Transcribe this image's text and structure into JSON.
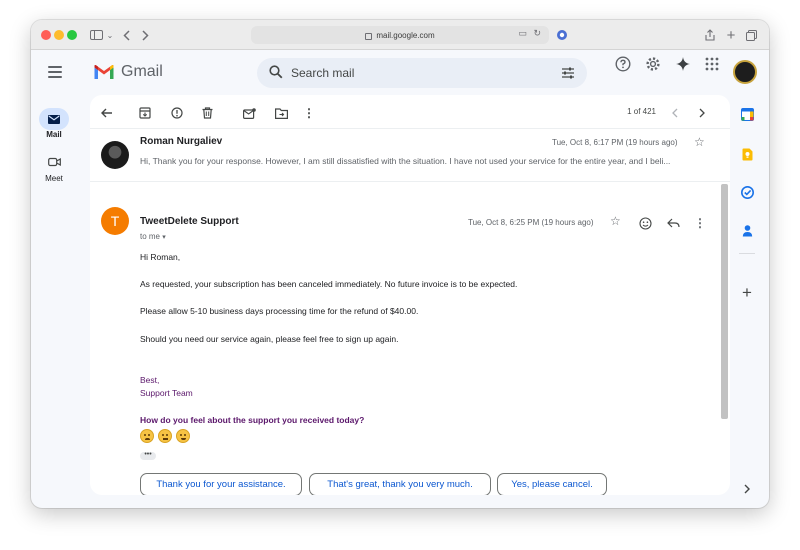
{
  "browser": {
    "url": "mail.google.com"
  },
  "gmail": {
    "logo_text": "Gmail",
    "search_placeholder": "Search mail"
  },
  "nav": {
    "mail_label": "Mail",
    "meet_label": "Meet"
  },
  "toolbar": {
    "pager": "1 of 421"
  },
  "thread": {
    "message1": {
      "sender": "Roman Nurgaliev",
      "date": "Tue, Oct 8, 6:17 PM (19 hours ago)",
      "snippet": "Hi, Thank you for your response. However, I am still dissatisfied with the situation. I have not used your service for the entire year, and I beli..."
    },
    "message2": {
      "avatar_letter": "T",
      "sender": "TweetDelete Support",
      "to": "to me",
      "date": "Tue, Oct 8, 6:25 PM (19 hours ago)",
      "body": [
        "Hi Roman,",
        "As requested, your subscription has been canceled immediately. No future invoice is to be expected.",
        "Please allow 5-10 business days processing time for the refund of $40.00.",
        "Should you need our service again, please feel free to sign up again."
      ],
      "signature": [
        "Best,",
        "Support Team"
      ],
      "question": "How do you feel about the support you received today?",
      "more": "•••"
    }
  },
  "smart_replies": [
    "Thank you for your assistance.",
    "That's great, thank you very much.",
    "Yes, please cancel."
  ],
  "colors": {
    "accent": "#0b57d0",
    "signature_purple": "#5b176b",
    "avatar_orange": "#f57c00"
  }
}
